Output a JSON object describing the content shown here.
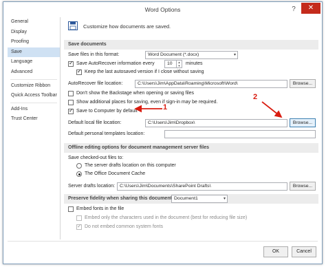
{
  "window": {
    "title": "Word Options",
    "help_glyph": "?",
    "close_glyph": "✕"
  },
  "nav": {
    "items": [
      {
        "label": "General",
        "active": false
      },
      {
        "label": "Display",
        "active": false
      },
      {
        "label": "Proofing",
        "active": false
      },
      {
        "label": "Save",
        "active": true
      },
      {
        "label": "Language",
        "active": false
      },
      {
        "label": "Advanced",
        "active": false
      },
      {
        "label": "Customize Ribbon",
        "active": false
      },
      {
        "label": "Quick Access Toolbar",
        "active": false
      },
      {
        "label": "Add-Ins",
        "active": false
      },
      {
        "label": "Trust Center",
        "active": false
      }
    ]
  },
  "header": {
    "text": "Customize how documents are saved."
  },
  "save_documents": {
    "section_title": "Save documents",
    "format_label": "Save files in this format:",
    "format_value": "Word Document (*.docx)",
    "autorecover_label": "Save AutoRecover information every",
    "autorecover_minutes": "10",
    "minutes_label": "minutes",
    "keep_last_label": "Keep the last autosaved version if I close without saving",
    "autorecover_location_label": "AutoRecover file location:",
    "autorecover_location_value": "C:\\Users\\Jim\\AppData\\Roaming\\Microsoft\\Word\\",
    "browse_label": "Browse...",
    "backstage_label": "Don't show the Backstage when opening or saving files",
    "show_additional_label": "Show additional places for saving, even if sign-in may be required.",
    "save_to_computer_label": "Save to Computer by default",
    "default_local_label": "Default local file location:",
    "default_local_value": "C:\\Users\\Jim\\Dropbox\\",
    "personal_templates_label": "Default personal templates location:",
    "personal_templates_value": ""
  },
  "offline": {
    "section_title": "Offline editing options for document management server files",
    "checked_out_label": "Save checked-out files to:",
    "server_drafts_label": "The server drafts location on this computer",
    "office_cache_label": "The Office Document Cache",
    "server_drafts_location_label": "Server drafts location:",
    "server_drafts_location_value": "C:\\Users\\Jim\\Documents\\SharePoint Drafts\\",
    "browse_label": "Browse..."
  },
  "fidelity": {
    "section_title": "Preserve fidelity when sharing this document:",
    "document_value": "Document1",
    "embed_fonts_label": "Embed fonts in the file",
    "embed_only_label": "Embed only the characters used in the document (best for reducing file size)",
    "no_common_label": "Do not embed common system fonts"
  },
  "footer": {
    "ok_label": "OK",
    "cancel_label": "Cancel"
  },
  "annotations": {
    "callout_1": "1",
    "callout_2": "2",
    "color": "#d91c10"
  },
  "icons": {
    "dropdown": "▾",
    "spin_up": "▲",
    "spin_down": "▼"
  }
}
